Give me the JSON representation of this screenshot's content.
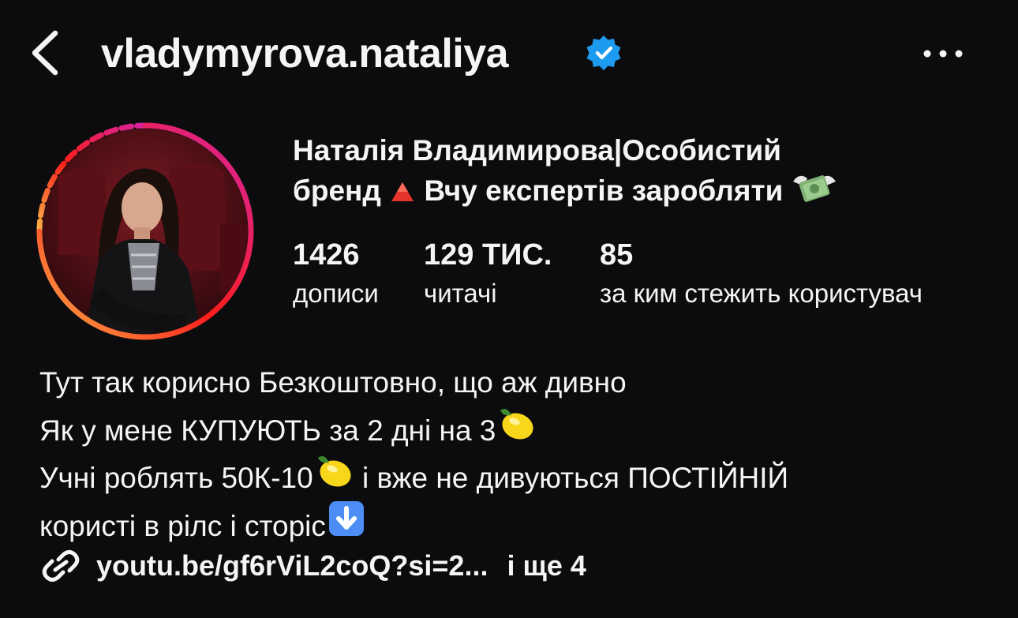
{
  "header": {
    "username": "vladymyrova.nataliya",
    "verified": true,
    "back_icon": "chevron-left-icon",
    "more_icon": "more-horizontal-icon"
  },
  "profile": {
    "name_line1": "Наталія Владимирова|Особистий",
    "name_line2_a": "бренд",
    "name_line2_b": "Вчу експертів заробляти",
    "stats": {
      "posts_value": "1426",
      "posts_label": "дописи",
      "followers_value": "129 ТИС.",
      "followers_label": "читачі",
      "following_value": "85",
      "following_label": "за ким стежить користувач"
    }
  },
  "bio": {
    "line1": "Тут так корисно Безкоштовно, що аж дивно",
    "line2": "Як у мене КУПУЮТЬ за 2 дні на 3",
    "line3_a": "Учні роблять 50К-10",
    "line3_b": " і вже не дивуються ПОСТІЙНІЙ",
    "line4": "користі в рілс і сторіс"
  },
  "link": {
    "url": "youtu.be/gf6rViL2coQ?si=2...",
    "more": "і ще 4"
  },
  "colors": {
    "background": "#0c0c0e",
    "text": "#f5f5f5",
    "verified": "#1d9bf0",
    "story_ring_start": "#fcb045",
    "story_ring_mid": "#fd1d1d",
    "story_ring_end": "#d6249f"
  }
}
